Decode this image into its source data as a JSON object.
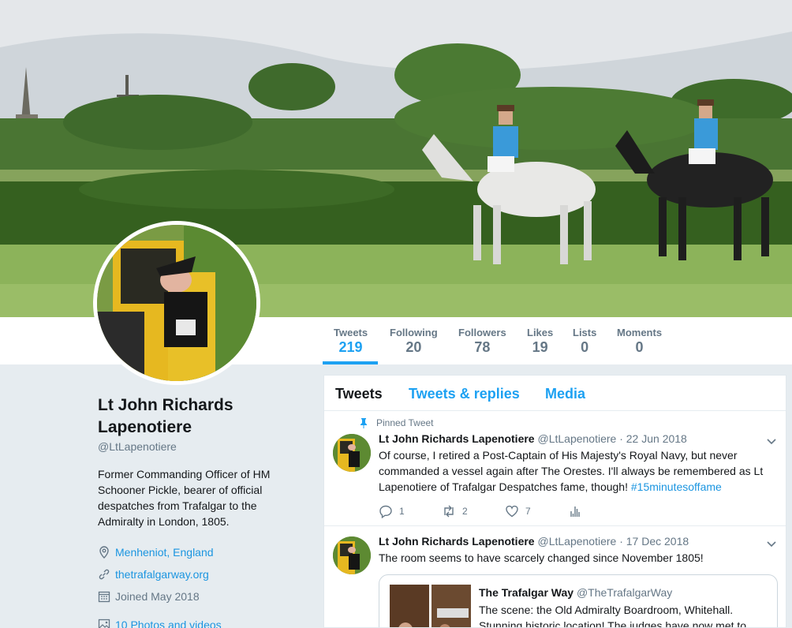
{
  "nav": {
    "stats": [
      {
        "label": "Tweets",
        "value": "219"
      },
      {
        "label": "Following",
        "value": "20"
      },
      {
        "label": "Followers",
        "value": "78"
      },
      {
        "label": "Likes",
        "value": "19"
      },
      {
        "label": "Lists",
        "value": "0"
      },
      {
        "label": "Moments",
        "value": "0"
      }
    ]
  },
  "profile": {
    "name": "Lt John Richards Lapenotiere",
    "handle": "@LtLapenotiere",
    "bio": "Former Commanding Officer of HM Schooner Pickle, bearer of official despatches from Trafalgar to the Admiralty in London, 1805.",
    "location": "Menheniot, England",
    "website": "thetrafalgarway.org",
    "joined": "Joined May 2018",
    "photos": "10 Photos and videos"
  },
  "tabs": [
    "Tweets",
    "Tweets & replies",
    "Media"
  ],
  "tweets": [
    {
      "pinned_label": "Pinned Tweet",
      "name": "Lt John Richards Lapenotiere",
      "meta": "@LtLapenotiere · 22 Jun 2018",
      "text": "Of course, I retired a Post-Captain of His Majesty's Royal Navy, but never commanded a vessel again after The Orestes. I'll always be remembered as Lt Lapenotiere of Trafalgar Despatches fame, though! ",
      "hashtag": "#15minutesoffame",
      "replies": "1",
      "retweets": "2",
      "likes": "7"
    },
    {
      "name": "Lt John Richards Lapenotiere",
      "meta": "@LtLapenotiere · 17 Dec 2018",
      "text": "The room seems to have scarcely changed since November 1805!",
      "quote": {
        "name": "The Trafalgar Way",
        "handle": "@TheTrafalgarWay",
        "text": "The scene: the Old Admiralty Boardroom, Whitehall. Stunning historic location! The judges have now met to"
      }
    }
  ],
  "colors": {
    "accent": "#1da1f2",
    "link": "#1b95e0",
    "muted": "#657786",
    "bg": "#e6ecf0"
  }
}
